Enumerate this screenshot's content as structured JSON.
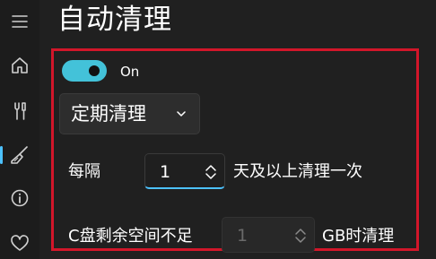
{
  "page": {
    "title": "自动清理"
  },
  "nav": {
    "items": [
      "menu",
      "home",
      "tools",
      "clean",
      "info",
      "favorites"
    ]
  },
  "toggle": {
    "state": "On",
    "checked": true
  },
  "schedule": {
    "mode": "定期清理"
  },
  "interval": {
    "prefix": "每隔",
    "value": "1",
    "suffix": "天及以上清理一次"
  },
  "space": {
    "prefix": "C盘剩余空间不足",
    "value": "1",
    "suffix": "GB时清理",
    "disabled": true
  },
  "colors": {
    "accent": "#43c2d9",
    "highlight_frame": "#d2162a",
    "background": "#202020"
  }
}
